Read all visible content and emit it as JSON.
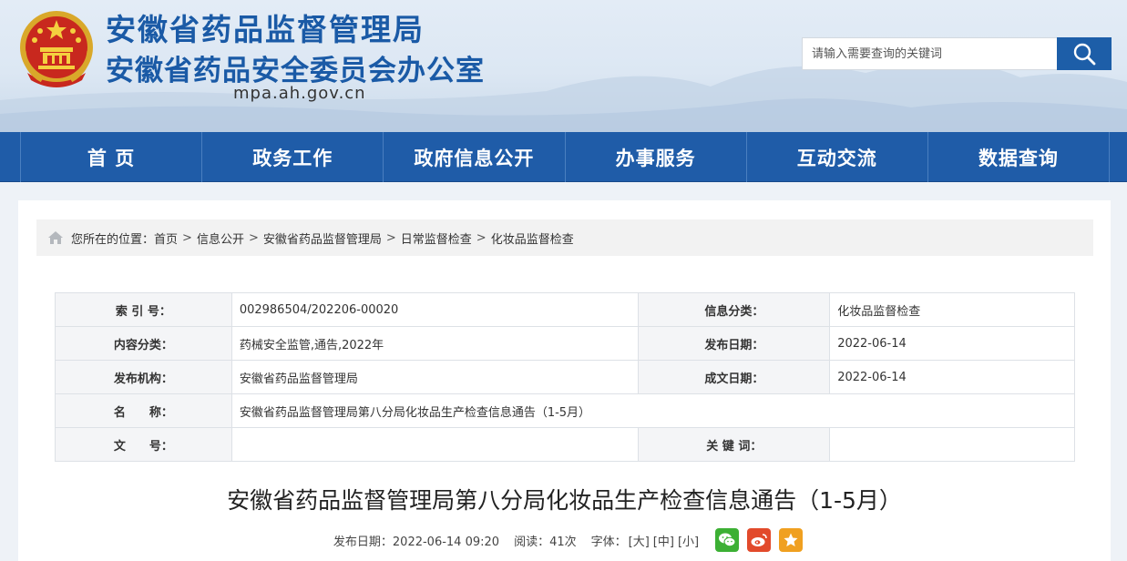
{
  "header": {
    "title": "安徽省药品监督管理局",
    "subtitle": "安徽省药品安全委员会办公室",
    "domain": "mpa.ah.gov.cn",
    "search_placeholder": "请输入需要查询的关键词"
  },
  "nav": [
    "首 页",
    "政务工作",
    "政府信息公开",
    "办事服务",
    "互动交流",
    "数据查询"
  ],
  "breadcrumb": {
    "prefix": "您所在的位置：",
    "items": [
      "首页",
      "信息公开",
      "安徽省药品监督管理局",
      "日常监督检查",
      "化妆品监督检查"
    ],
    "separator": ">"
  },
  "meta": {
    "index_label": "索 引 号：",
    "index_value": "002986504/202206-00020",
    "info_category_label": "信息分类：",
    "info_category_value": "化妆品监督检查",
    "content_category_label": "内容分类：",
    "content_category_value": "药械安全监管,通告,2022年",
    "publish_date_label": "发布日期：",
    "publish_date_value": "2022-06-14",
    "org_label": "发布机构：",
    "org_value": "安徽省药品监督管理局",
    "written_date_label": "成文日期：",
    "written_date_value": "2022-06-14",
    "name_label": "名　　称：",
    "name_value": "安徽省药品监督管理局第八分局化妆品生产检查信息通告（1-5月）",
    "doc_no_label": "文　　号：",
    "doc_no_value": "",
    "keywords_label": "关 键 词：",
    "keywords_value": ""
  },
  "article": {
    "title": "安徽省药品监督管理局第八分局化妆品生产检查信息通告（1-5月）",
    "publish_info": "发布日期：2022-06-14 09:20",
    "reads": "阅读：41次",
    "font_label": "字体：",
    "font_large": "[大]",
    "font_medium": "[中]",
    "font_small": "[小]"
  },
  "share": {
    "wechat": {
      "icon": "wechat-icon",
      "color": "#3cb034"
    },
    "weibo": {
      "icon": "weibo-icon",
      "color": "#e24a2b"
    },
    "favorite": {
      "icon": "star-icon",
      "color": "#f0a020"
    }
  },
  "colors": {
    "brand_blue": "#1a5aa6",
    "nav_blue": "#1f5ca8"
  }
}
